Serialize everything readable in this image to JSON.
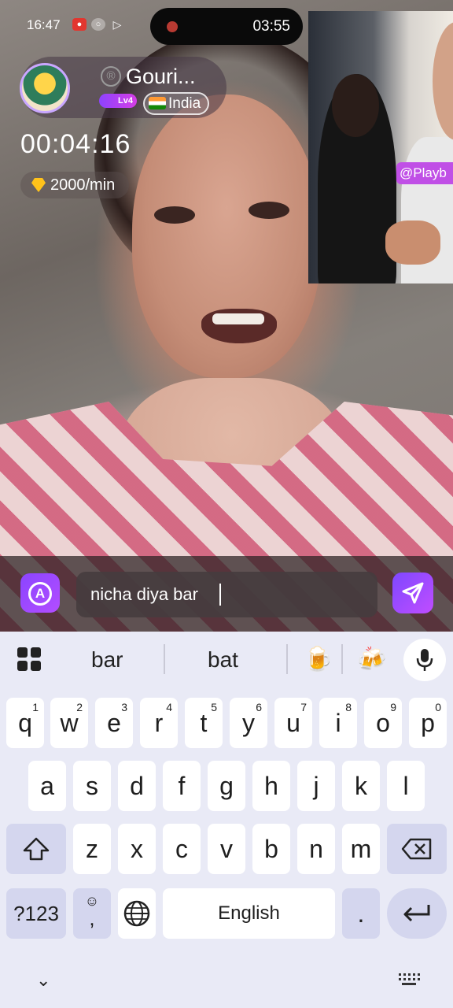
{
  "status_bar": {
    "time": "16:47"
  },
  "call_timer": {
    "time": "03:55"
  },
  "profile": {
    "name": "Gouri...",
    "level": "Lv4",
    "country": "India"
  },
  "call": {
    "duration": "00:04:16",
    "rate": "2000/min"
  },
  "pip": {
    "tag": "@Playb"
  },
  "message": {
    "value": "nicha diya bar",
    "translate_label": "A"
  },
  "keyboard": {
    "suggestions": [
      "bar",
      "bat"
    ],
    "rows": [
      [
        {
          "k": "q",
          "n": "1"
        },
        {
          "k": "w",
          "n": "2"
        },
        {
          "k": "e",
          "n": "3"
        },
        {
          "k": "r",
          "n": "4"
        },
        {
          "k": "t",
          "n": "5"
        },
        {
          "k": "y",
          "n": "6"
        },
        {
          "k": "u",
          "n": "7"
        },
        {
          "k": "i",
          "n": "8"
        },
        {
          "k": "o",
          "n": "9"
        },
        {
          "k": "p",
          "n": "0"
        }
      ],
      [
        {
          "k": "a"
        },
        {
          "k": "s"
        },
        {
          "k": "d"
        },
        {
          "k": "f"
        },
        {
          "k": "g"
        },
        {
          "k": "h"
        },
        {
          "k": "j"
        },
        {
          "k": "k"
        },
        {
          "k": "l"
        }
      ],
      [
        {
          "k": "z"
        },
        {
          "k": "x"
        },
        {
          "k": "c"
        },
        {
          "k": "v"
        },
        {
          "k": "b"
        },
        {
          "k": "n"
        },
        {
          "k": "m"
        }
      ]
    ],
    "symbols_label": "?123",
    "comma_label": ",",
    "space_label": "English",
    "period_label": "."
  }
}
